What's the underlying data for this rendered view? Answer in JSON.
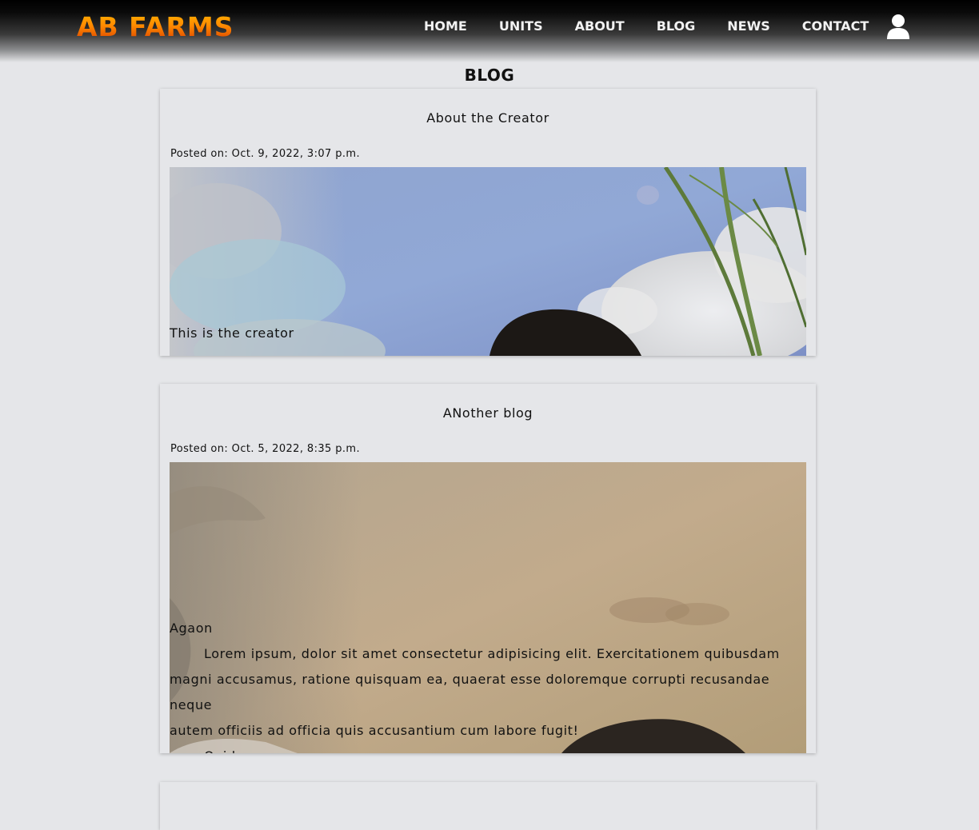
{
  "brand": {
    "logo_text": "AB FARMS"
  },
  "nav": {
    "items": [
      {
        "label": "HOME"
      },
      {
        "label": "UNITS"
      },
      {
        "label": "ABOUT"
      },
      {
        "label": "BLOG"
      },
      {
        "label": "NEWS"
      },
      {
        "label": "CONTACT"
      }
    ],
    "user_icon": "user-icon"
  },
  "page": {
    "title": "BLOG"
  },
  "posts": [
    {
      "title": "About the Creator",
      "posted": "Posted on: Oct. 9, 2022, 3:07 p.m.",
      "excerpt": "This is the creator"
    },
    {
      "title": "ANother blog",
      "posted": "Posted on: Oct. 5, 2022, 8:35 p.m.",
      "excerpt_heading": "Agaon",
      "excerpt_line1": "Lorem ipsum, dolor sit amet consectetur adipisicing elit. Exercitationem quibusdam",
      "excerpt_line2": "magni accusamus, ratione quisquam ea, quaerat esse doloremque corrupti recusandae neque",
      "excerpt_line3": "autem officiis ad officia quis accusantium cum labore fugit!",
      "excerpt_more": "Quidem ..."
    }
  ],
  "colors": {
    "background": "#e5e6e9",
    "logo_top": "#ffb300",
    "logo_bottom": "#d63a00",
    "nav_text": "#f2f2f2"
  }
}
